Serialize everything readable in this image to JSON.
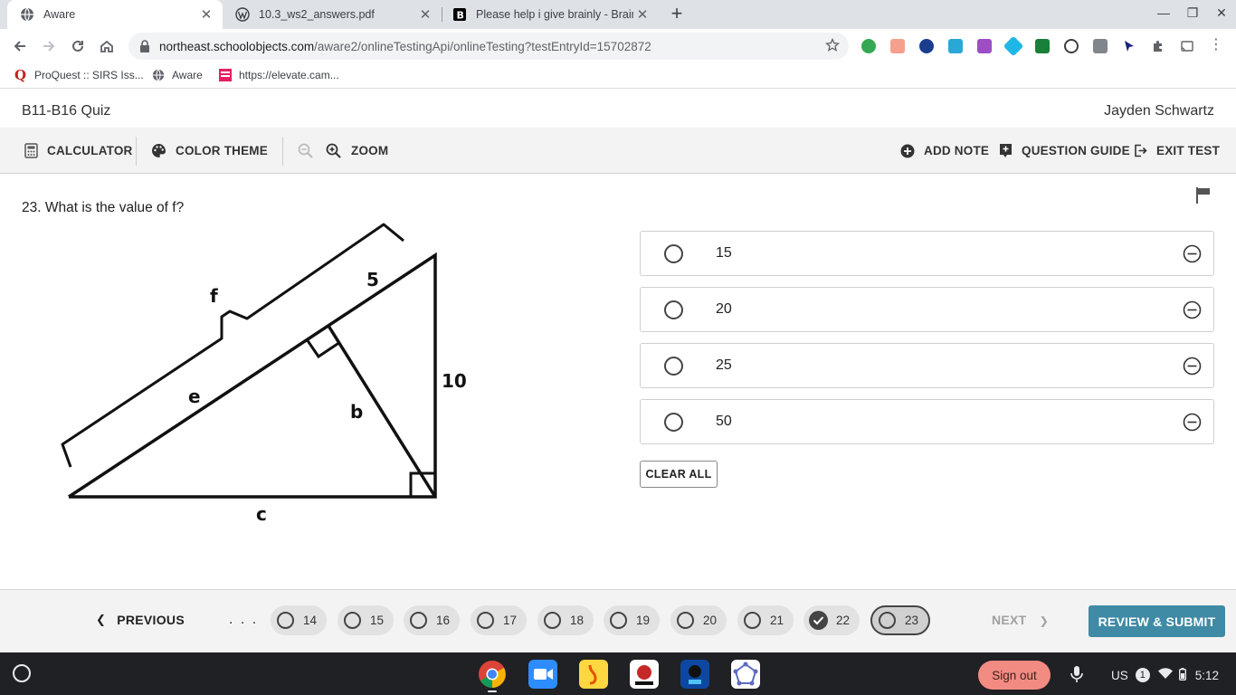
{
  "browser": {
    "tabs": [
      {
        "title": "Aware",
        "active": true
      },
      {
        "title": "10.3_ws2_answers.pdf",
        "active": false
      },
      {
        "title": "Please help i give brainly - Brainly",
        "active": false
      }
    ],
    "url_host": "northeast.schoolobjects.com",
    "url_path": "/aware2/onlineTestingApi/onlineTesting?testEntryId=15702872",
    "bookmarks": [
      "ProQuest :: SIRS Iss...",
      "Aware",
      "https://elevate.cam..."
    ]
  },
  "header": {
    "quiz_title": "B11-B16 Quiz",
    "student_name": "Jayden Schwartz"
  },
  "toolbar": {
    "calculator": "CALCULATOR",
    "color_theme": "COLOR THEME",
    "zoom": "ZOOM",
    "add_note": "ADD NOTE",
    "question_guide": "QUESTION GUIDE",
    "exit_test": "EXIT TEST"
  },
  "question": {
    "text": "23. What is the value of f?",
    "figure_labels": {
      "f": "f",
      "five": "5",
      "e": "e",
      "b": "b",
      "ten": "10",
      "c": "c"
    }
  },
  "answers": [
    {
      "value": "15"
    },
    {
      "value": "20"
    },
    {
      "value": "25"
    },
    {
      "value": "50"
    }
  ],
  "clear_all": "CLEAR ALL",
  "nav": {
    "previous": "PREVIOUS",
    "ellipsis": ". . .",
    "questions": [
      {
        "num": "14",
        "state": "unanswered"
      },
      {
        "num": "15",
        "state": "unanswered"
      },
      {
        "num": "16",
        "state": "unanswered"
      },
      {
        "num": "17",
        "state": "unanswered"
      },
      {
        "num": "18",
        "state": "unanswered"
      },
      {
        "num": "19",
        "state": "unanswered"
      },
      {
        "num": "20",
        "state": "unanswered"
      },
      {
        "num": "21",
        "state": "unanswered"
      },
      {
        "num": "22",
        "state": "answered"
      },
      {
        "num": "23",
        "state": "current"
      }
    ],
    "next": "NEXT",
    "review_submit": "REVIEW & SUBMIT"
  },
  "shelf": {
    "sign_out": "Sign out",
    "keyboard_layout": "US",
    "notification_count": "1",
    "time": "5:12"
  },
  "colors": {
    "review_button": "#3f8aa5",
    "sign_out": "#f28b82"
  }
}
